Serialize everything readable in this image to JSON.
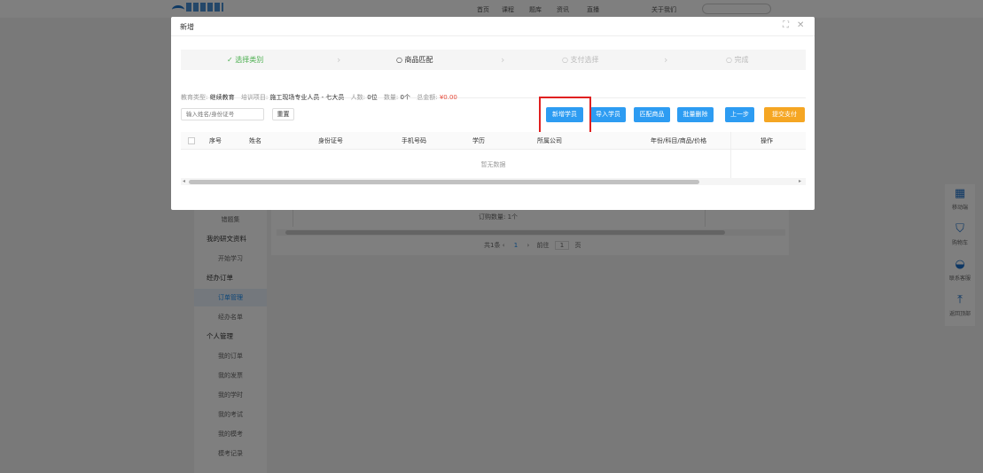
{
  "background": {
    "nav": [
      "首页",
      "课程",
      "题库",
      "资讯",
      "直播",
      "关于我们"
    ],
    "sidebar": [
      {
        "label": "错题集",
        "type": "item"
      },
      {
        "label": "我的研文资料",
        "type": "group"
      },
      {
        "label": "开始学习",
        "type": "item"
      },
      {
        "label": "经办订单",
        "type": "group"
      },
      {
        "label": "订单管理",
        "type": "item",
        "active": true
      },
      {
        "label": "经办名单",
        "type": "item"
      },
      {
        "label": "个人管理",
        "type": "group"
      },
      {
        "label": "我的订单",
        "type": "item"
      },
      {
        "label": "我的发票",
        "type": "item"
      },
      {
        "label": "我的学时",
        "type": "item"
      },
      {
        "label": "我的考试",
        "type": "item"
      },
      {
        "label": "我的模考",
        "type": "item"
      },
      {
        "label": "模考记录",
        "type": "item"
      }
    ],
    "order_count": "订购数量: 1个",
    "pager": {
      "total": "共1条",
      "current": "1",
      "goto_label": "前往",
      "page_value": "1",
      "page_unit": "页"
    }
  },
  "right_tools": [
    {
      "icon": "qrcode-icon",
      "glyph": "▦",
      "label": "移动端"
    },
    {
      "icon": "cart-icon",
      "glyph": "⛉",
      "label": "购物车"
    },
    {
      "icon": "headset-icon",
      "glyph": "◒",
      "label": "联系客服"
    },
    {
      "icon": "top-icon",
      "glyph": "⤒",
      "label": "返回顶部"
    }
  ],
  "modal": {
    "title": "新增",
    "steps": [
      {
        "label": "选择类别",
        "status": "done",
        "icon": "✓"
      },
      {
        "label": "商品匹配",
        "status": "active",
        "icon": "○"
      },
      {
        "label": "支付选择",
        "status": "pending",
        "icon": "○"
      },
      {
        "label": "完成",
        "status": "pending",
        "icon": "○"
      }
    ],
    "info": {
      "edu_type_label": "教育类型:",
      "edu_type": "继续教育",
      "project_label": "培训项目:",
      "project": "施工现场专业人员 - 七大员",
      "people_label": "人数:",
      "people": "0位",
      "qty_label": "数量:",
      "qty": "0个",
      "total_label": "总金额:",
      "total": "¥0.00"
    },
    "search_placeholder": "输入姓名/身份证号",
    "reset_label": "重置",
    "buttons": {
      "add_student": "新增学员",
      "import_student": "导入学员",
      "match_goods": "匹配商品",
      "batch_delete": "批量删除",
      "prev_step": "上一步",
      "submit_pay": "提交支付"
    },
    "table": {
      "headers": [
        "序号",
        "姓名",
        "身份证号",
        "手机号码",
        "学历",
        "所属公司",
        "年份/科目/商品/价格",
        "操作"
      ],
      "empty_text": "暂无数据"
    }
  },
  "colors": {
    "primary": "#2d9cf2",
    "warning": "#f5a623",
    "success": "#4caf50",
    "highlight": "#e02020",
    "money": "#e74c3c"
  }
}
